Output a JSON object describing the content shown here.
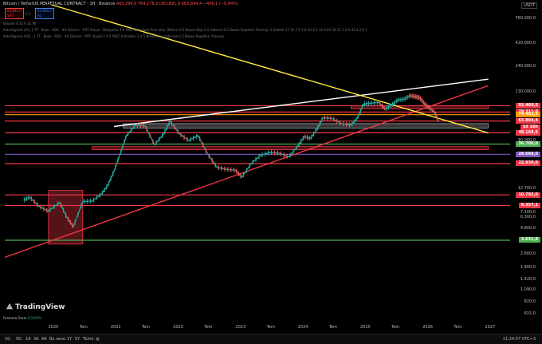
{
  "header": {
    "title": "Bitcoin / TetherUS PERPETUAL CONTRACT · 1H · Binance",
    "ohlc": "A63,299,0 Y64,178,5 D63,891,9 K63,894,4 −406,1 (−0,64%)"
  },
  "order_boxes": {
    "sell_price": "63,891,9",
    "sell_label": "SAT",
    "buy_price": "63,892,0",
    "buy_label": "AL",
    "spread": "0,1"
  },
  "indicators": [
    "Volume  4.35 K  31 Mr",
    "AstroSignals [AL] 1 TF · Base · ADX · 4% Dönem · MTF Sinyal · Maliyetler 1.0 FAST (Intrabar) Pres ekip (Tether) 0.5 Bazen Ekip 0.5 Galtech 0.5 Bazen Sepetleri Yüzmeyi 3 Olabilir 17 15 7.5 1.6 10 4.5 10 0.25 30 15 1.2 0.45 0.2 0 1",
    "AstroSignals [AS] · 1 TF · Base · ADX · 4% Dönem · MTF Sinyal 1 0.5 FAST (Intrabar) 1 0.5 Break pres high low 0.5 Bazen Sepetleri Yüzmeyi"
  ],
  "auto_label": "USDT",
  "chart_data": {
    "type": "line",
    "title": "",
    "y_scale": "log",
    "y_ticks": [
      "760.000,0",
      "420.000,0",
      "240.000,0",
      "130.000,0",
      "73.000,0",
      "40.000,0",
      "22.900,0",
      "12.700,0",
      "7.100,0",
      "6.300,0",
      "4.800,0",
      "3.550,0",
      "2.600,0",
      "1.900,0",
      "1.420,0",
      "1.090,0",
      "820,0",
      "615,0"
    ],
    "y_tick_values": [
      760000,
      420000,
      240000,
      130000,
      73000,
      40000,
      22900,
      12700,
      7100,
      6300,
      4800,
      3550,
      2600,
      1900,
      1420,
      1090,
      820,
      615
    ],
    "x_ticks": [
      "2020",
      "Tem",
      "2021",
      "Tem",
      "2022",
      "Tem",
      "2023",
      "Tem",
      "2024",
      "Tem",
      "2025",
      "Tem",
      "2026",
      "Tem",
      "2027"
    ],
    "x_tick_values": [
      2020.0,
      2020.5,
      2021.0,
      2021.5,
      2022.0,
      2022.5,
      2023.0,
      2023.5,
      2024.0,
      2024.5,
      2025.0,
      2025.5,
      2026.0,
      2026.5,
      2027.0
    ],
    "xlim": [
      2019.2,
      2027.3
    ],
    "ylim": [
      540,
      1050000
    ],
    "price_series": {
      "x": [
        2019.5,
        2019.6,
        2019.75,
        2019.9,
        2020.08,
        2020.2,
        2020.3,
        2020.45,
        2020.6,
        2020.75,
        2020.85,
        2020.95,
        2021.08,
        2021.15,
        2021.3,
        2021.45,
        2021.6,
        2021.75,
        2021.85,
        2022.0,
        2022.15,
        2022.3,
        2022.45,
        2022.6,
        2022.75,
        2022.9,
        2023.0,
        2023.15,
        2023.3,
        2023.45,
        2023.6,
        2023.75,
        2023.9,
        2024.0,
        2024.1,
        2024.2,
        2024.3,
        2024.45,
        2024.6,
        2024.75,
        2024.85,
        2024.95,
        2025.05,
        2025.2,
        2025.3,
        2025.4,
        2025.5,
        2025.6,
        2025.7,
        2025.78,
        2025.85,
        2025.92,
        2026.0,
        2026.1,
        2026.15
      ],
      "y": [
        9500,
        10200,
        8200,
        7300,
        9000,
        6200,
        5000,
        9200,
        9300,
        11000,
        13500,
        19000,
        33000,
        45000,
        58000,
        57000,
        36000,
        47000,
        64000,
        47000,
        40000,
        45000,
        29000,
        21000,
        20000,
        19500,
        16500,
        23000,
        28000,
        30000,
        29500,
        27000,
        35000,
        44000,
        42000,
        52000,
        69000,
        68000,
        60000,
        58000,
        68000,
        96000,
        98000,
        100000,
        85000,
        94000,
        106000,
        108000,
        118000,
        115000,
        112000,
        98000,
        88000,
        78000,
        63894
      ]
    },
    "levels": [
      {
        "price": 92400,
        "label": "92.460,5",
        "color": "#f23645"
      },
      {
        "price": 79311,
        "label": "79.311,0",
        "color": "#f23645"
      },
      {
        "price": 74481,
        "label": "74.481,5",
        "color": "#ff9800"
      },
      {
        "price": 63894,
        "label": "63.894,4",
        "color": "#f23645"
      },
      {
        "price": 48168,
        "label": "48.168,6",
        "color": "#f23645"
      },
      {
        "price": 36700,
        "label": "36.700,0",
        "color": "#4caf50"
      },
      {
        "price": 28688,
        "label": "28.688,0",
        "color": "#7e57c2"
      },
      {
        "price": 22930,
        "label": "22.930,0",
        "color": "#f23645"
      },
      {
        "price": 10792,
        "label": "10.792,0",
        "color": "#f23645"
      },
      {
        "price": 8357,
        "label": "8.357,1",
        "color": "#f23645"
      },
      {
        "price": 3621,
        "label": "3.621,8",
        "color": "#4caf50"
      }
    ],
    "countdown": "3d 16h",
    "trendlines": [
      {
        "x1": 2019.2,
        "y1": 2400,
        "x2": 2026.95,
        "y2": 150000,
        "color": "#f23645"
      },
      {
        "x1": 2020.95,
        "y1": 56000,
        "x2": 2026.95,
        "y2": 175000,
        "color": "#ffffff"
      },
      {
        "x1": 2019.95,
        "y1": 1050000,
        "x2": 2026.95,
        "y2": 48000,
        "color": "#ffeb3b"
      }
    ],
    "zones": [
      {
        "x1": 2019.9,
        "x2": 2020.45,
        "y1": 3300,
        "y2": 12000,
        "color": "#f23645"
      },
      {
        "x1": 2021.1,
        "x2": 2026.95,
        "y1": 54000,
        "y2": 60000,
        "color": "#9e9e9e"
      },
      {
        "x1": 2020.6,
        "x2": 2026.95,
        "y1": 32000,
        "y2": 34500,
        "color": "#f23645"
      },
      {
        "x1": 2024.75,
        "x2": 2026.95,
        "y1": 86000,
        "y2": 92000,
        "color": "#f23645"
      }
    ]
  },
  "footer": {
    "brand": "TradingView",
    "funding_label": "Fonlama Oranı",
    "funding_value": "0,0029%",
    "timeframes": [
      "1G",
      "5G",
      "1A",
      "3A",
      "6A",
      "Bu sene",
      "1Y",
      "5Y",
      "Tümü"
    ],
    "clock": "11:24:07 UTC+3"
  }
}
